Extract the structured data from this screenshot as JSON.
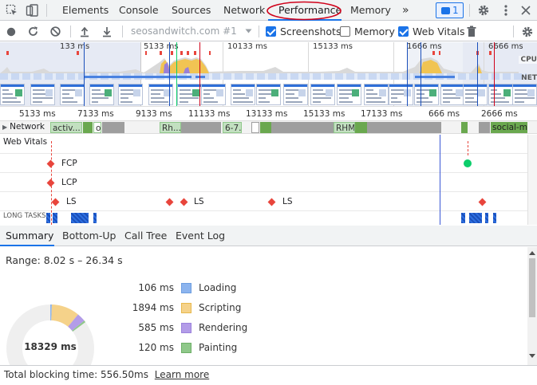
{
  "tabs": {
    "items": [
      "Elements",
      "Console",
      "Sources",
      "Network",
      "Performance",
      "Memory"
    ],
    "more_label": "»",
    "messages_count": "1"
  },
  "toolbar": {
    "recording_name": "seosandwitch.com #1",
    "screenshots_label": "Screenshots",
    "screenshots_checked": true,
    "memory_label": "Memory",
    "memory_checked": false,
    "web_vitals_label": "Web Vitals",
    "web_vitals_checked": true
  },
  "overview": {
    "ticks": [
      "133 ms",
      "5133 ms",
      "10133 ms",
      "15133 ms",
      "1666 ms",
      "6666 ms"
    ],
    "cpu_label": "CPU",
    "net_label": "NET"
  },
  "timeline": {
    "ticks": [
      "5133 ms",
      "7133 ms",
      "9133 ms",
      "11133 ms",
      "13133 ms",
      "15133 ms",
      "17133 ms",
      "666 ms",
      "2666 ms"
    ],
    "network_label": "Network",
    "network_items": [
      "activ...",
      "o",
      "Rh...",
      "6-7...",
      "RHM...",
      "social-m"
    ]
  },
  "web_vitals": {
    "title": "Web Vitals",
    "fcp_label": "FCP",
    "lcp_label": "LCP",
    "ls_label": "LS",
    "long_tasks_label": "LONG TASKS"
  },
  "bottom_tabs": [
    "Summary",
    "Bottom-Up",
    "Call Tree",
    "Event Log"
  ],
  "summary": {
    "range": "Range: 8.02 s – 26.34 s",
    "total": "18329 ms",
    "legend": [
      {
        "value": "106 ms",
        "name": "Loading",
        "color": "#8cb4ee",
        "border": "#6d9ee0"
      },
      {
        "value": "1894 ms",
        "name": "Scripting",
        "color": "#f5d28a",
        "border": "#e7b84d"
      },
      {
        "value": "585 ms",
        "name": "Rendering",
        "color": "#b39ce8",
        "border": "#9b82dc"
      },
      {
        "value": "120 ms",
        "name": "Painting",
        "color": "#8fc88a",
        "border": "#6daf67"
      }
    ]
  },
  "status_bar": {
    "blocking_time": "Total blocking time: 556.50ms",
    "learn_more": "Learn more"
  },
  "colors": {
    "accent": "#1a73e8",
    "annotation_red": "#d0021b",
    "fcp_green": "#0cce6b",
    "marker_red": "#e8453c"
  }
}
